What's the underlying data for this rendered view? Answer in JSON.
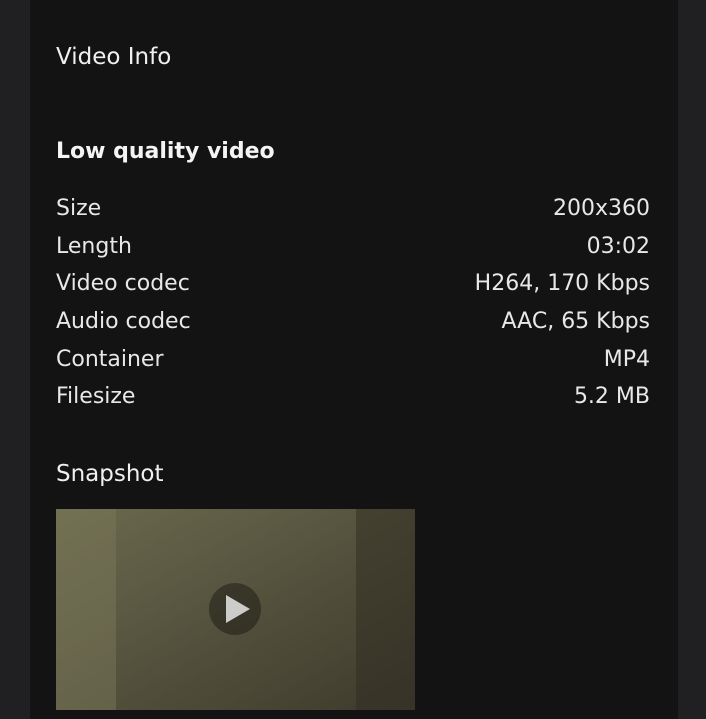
{
  "video_info": {
    "title": "Video Info",
    "quality_heading": "Low quality video",
    "rows": [
      {
        "label": "Size",
        "value": "200x360"
      },
      {
        "label": "Length",
        "value": "03:02"
      },
      {
        "label": "Video codec",
        "value": "H264, 170 Kbps"
      },
      {
        "label": "Audio codec",
        "value": "AAC, 65 Kbps"
      },
      {
        "label": "Container",
        "value": "MP4"
      },
      {
        "label": "Filesize",
        "value": "5.2 MB"
      }
    ]
  },
  "snapshot": {
    "title": "Snapshot",
    "image": "snapshot-thumbnail"
  }
}
